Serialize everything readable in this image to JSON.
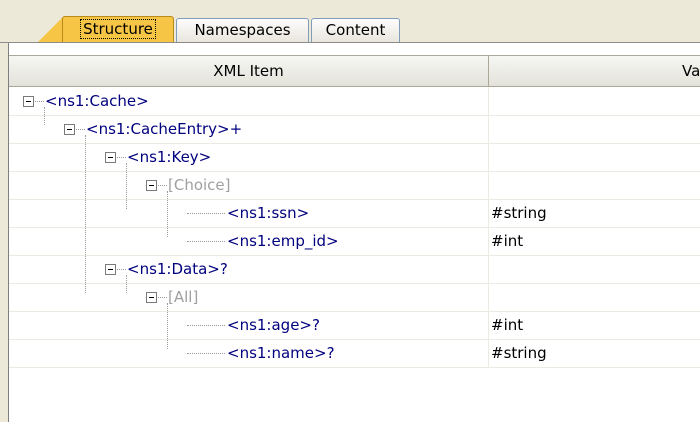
{
  "tabs": [
    {
      "label": "Structure",
      "active": true
    },
    {
      "label": "Namespaces",
      "active": false
    },
    {
      "label": "Content",
      "active": false
    }
  ],
  "table": {
    "columns": [
      "XML Item",
      "Val"
    ],
    "rows": [
      {
        "item": "<ns1:Cache>",
        "value": "",
        "expandable": true,
        "style": "element"
      },
      {
        "item": "<ns1:CacheEntry>+",
        "value": "",
        "expandable": true,
        "style": "element"
      },
      {
        "item": "<ns1:Key>",
        "value": "",
        "expandable": true,
        "style": "element"
      },
      {
        "item": "[Choice]",
        "value": "",
        "expandable": true,
        "style": "group"
      },
      {
        "item": "<ns1:ssn>",
        "value": "#string",
        "expandable": false,
        "style": "element"
      },
      {
        "item": "<ns1:emp_id>",
        "value": "#int",
        "expandable": false,
        "style": "element"
      },
      {
        "item": "<ns1:Data>?",
        "value": "",
        "expandable": true,
        "style": "element"
      },
      {
        "item": "[All]",
        "value": "",
        "expandable": true,
        "style": "group"
      },
      {
        "item": "<ns1:age>?",
        "value": "#int",
        "expandable": false,
        "style": "element"
      },
      {
        "item": "<ns1:name>?",
        "value": "#string",
        "expandable": false,
        "style": "element"
      }
    ]
  },
  "colors": {
    "active_tab": "#f7c545",
    "tree_text": "#00007f",
    "group_text": "#a0a0a0",
    "tab_border": "#7f9db9"
  }
}
